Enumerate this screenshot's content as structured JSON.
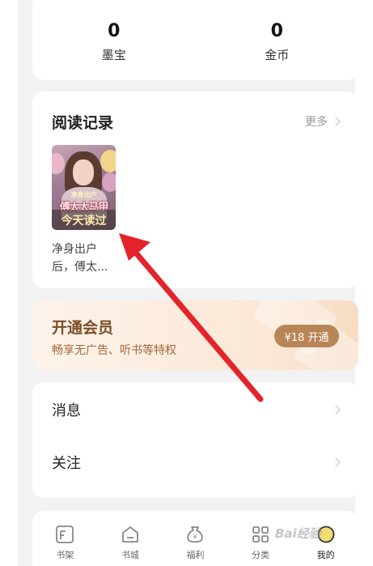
{
  "stats": [
    {
      "value": "0",
      "label": "墨宝"
    },
    {
      "value": "0",
      "label": "金币"
    }
  ],
  "reading": {
    "title": "阅读记录",
    "more": "更多",
    "book": {
      "cover_series": "净身出户",
      "cover_title": "傅太太马甲",
      "cover_banner": "今天读过",
      "title": "净身出户后，傅太..."
    }
  },
  "vip": {
    "title": "开通会员",
    "subtitle": "畅享无广告、听书等特权",
    "button": "¥18 开通"
  },
  "menu": [
    {
      "label": "消息"
    },
    {
      "label": "关注"
    }
  ],
  "tabs": [
    {
      "label": "书架",
      "icon": "bookshelf-icon"
    },
    {
      "label": "书城",
      "icon": "home-icon"
    },
    {
      "label": "福利",
      "icon": "money-bag-icon"
    },
    {
      "label": "分类",
      "icon": "grid-icon"
    },
    {
      "label": "我的",
      "icon": "profile-icon",
      "active": true
    }
  ],
  "watermark": "Bai经验",
  "colors": {
    "accent_gold": "#b88556",
    "annotation_arrow": "#e5232b"
  }
}
